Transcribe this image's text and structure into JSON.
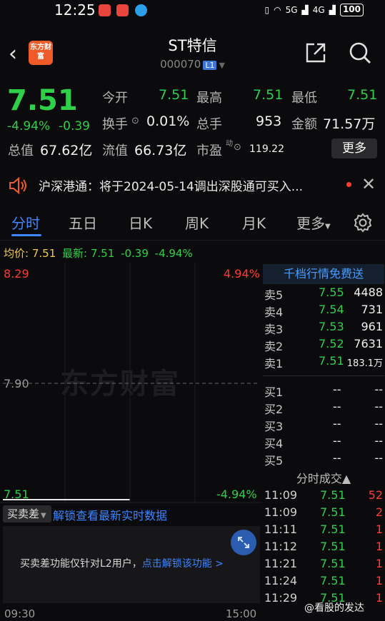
{
  "status_bar": {
    "time": "12:25",
    "network1": "5G",
    "network2": "4G",
    "battery": "100"
  },
  "header": {
    "logo_text": "东方财富",
    "stock_name": "ST特信",
    "stock_code": "000070",
    "level_badge": "L1"
  },
  "quote": {
    "price": "7.51",
    "change_pct": "-4.94%",
    "change_amt": "-0.39",
    "open_label": "今开",
    "open": "7.51",
    "high_label": "最高",
    "high": "7.51",
    "low_label": "最低",
    "low": "7.51",
    "turnover_label": "换手",
    "turnover": "0.01%",
    "volume_label": "总手",
    "volume": "953",
    "amount_label": "金额",
    "amount": "71.57万",
    "mktcap_label": "总值",
    "mktcap": "67.62亿",
    "float_label": "流值",
    "float_cap": "66.73亿",
    "pe_label": "市盈",
    "pe_sup": "动",
    "pe": "119.22",
    "more_button": "更多"
  },
  "notice": {
    "text": "沪深港通：将于2024-05-14调出深股通可买入..."
  },
  "tabs": [
    {
      "label": "分时",
      "active": true
    },
    {
      "label": "五日",
      "active": false
    },
    {
      "label": "日K",
      "active": false
    },
    {
      "label": "周K",
      "active": false
    },
    {
      "label": "月K",
      "active": false
    },
    {
      "label": "更多",
      "active": false
    }
  ],
  "chart_info": {
    "avg_label": "均价:",
    "avg": "7.51",
    "latest_label": "最新:",
    "latest": "7.51",
    "chg": "-0.39",
    "pct": "-4.94%"
  },
  "chart_data": {
    "type": "line",
    "y_top_label": "8.29",
    "y_mid_label": "7.90",
    "y_bottom_label": "7.51",
    "pct_top_label": "4.94%",
    "pct_bottom_label": "-4.94%",
    "ylim": [
      7.51,
      8.29
    ],
    "prev_close": 7.9,
    "series": [
      {
        "x": [
          "09:30",
          "11:29"
        ],
        "values": [
          7.51,
          7.51
        ]
      }
    ],
    "x_start": "09:30",
    "x_end": "15:00",
    "watermark": "东方财富"
  },
  "orderbook": {
    "promo": "千档行情免费送",
    "asks": [
      {
        "label": "卖5",
        "price": "7.55",
        "vol": "4488"
      },
      {
        "label": "卖4",
        "price": "7.54",
        "vol": "731"
      },
      {
        "label": "卖3",
        "price": "7.53",
        "vol": "961"
      },
      {
        "label": "卖2",
        "price": "7.52",
        "vol": "7631"
      },
      {
        "label": "卖1",
        "price": "7.51",
        "vol": "183.1万"
      }
    ],
    "bids": [
      {
        "label": "买1",
        "price": "--",
        "vol": "--"
      },
      {
        "label": "买2",
        "price": "--",
        "vol": "--"
      },
      {
        "label": "买3",
        "price": "--",
        "vol": "--"
      },
      {
        "label": "买4",
        "price": "--",
        "vol": "--"
      },
      {
        "label": "买5",
        "price": "--",
        "vol": "--"
      }
    ]
  },
  "ticks": {
    "header": "分时成交▲",
    "rows": [
      {
        "time": "11:09",
        "price": "7.51",
        "vol": "52"
      },
      {
        "time": "11:09",
        "price": "7.51",
        "vol": "2"
      },
      {
        "time": "11:11",
        "price": "7.51",
        "vol": "1"
      },
      {
        "time": "11:12",
        "price": "7.51",
        "vol": "1"
      },
      {
        "time": "11:21",
        "price": "7.51",
        "vol": "1"
      },
      {
        "time": "11:24",
        "price": "7.51",
        "vol": "1"
      },
      {
        "time": "11:29",
        "price": "7.51",
        "vol": "1"
      }
    ]
  },
  "bsd": {
    "tag": "买卖差",
    "unlock_link": "解锁查看最新实时数据",
    "msg": "买卖差功能仅针对L2用户，",
    "msg_link": "点击解锁该功能 >"
  },
  "author_watermark": "@看股的发达",
  "colors": {
    "up": "#ff3b30",
    "down": "#2fcf4a",
    "accent": "#3d86ff",
    "bg": "#0b0b0d"
  }
}
